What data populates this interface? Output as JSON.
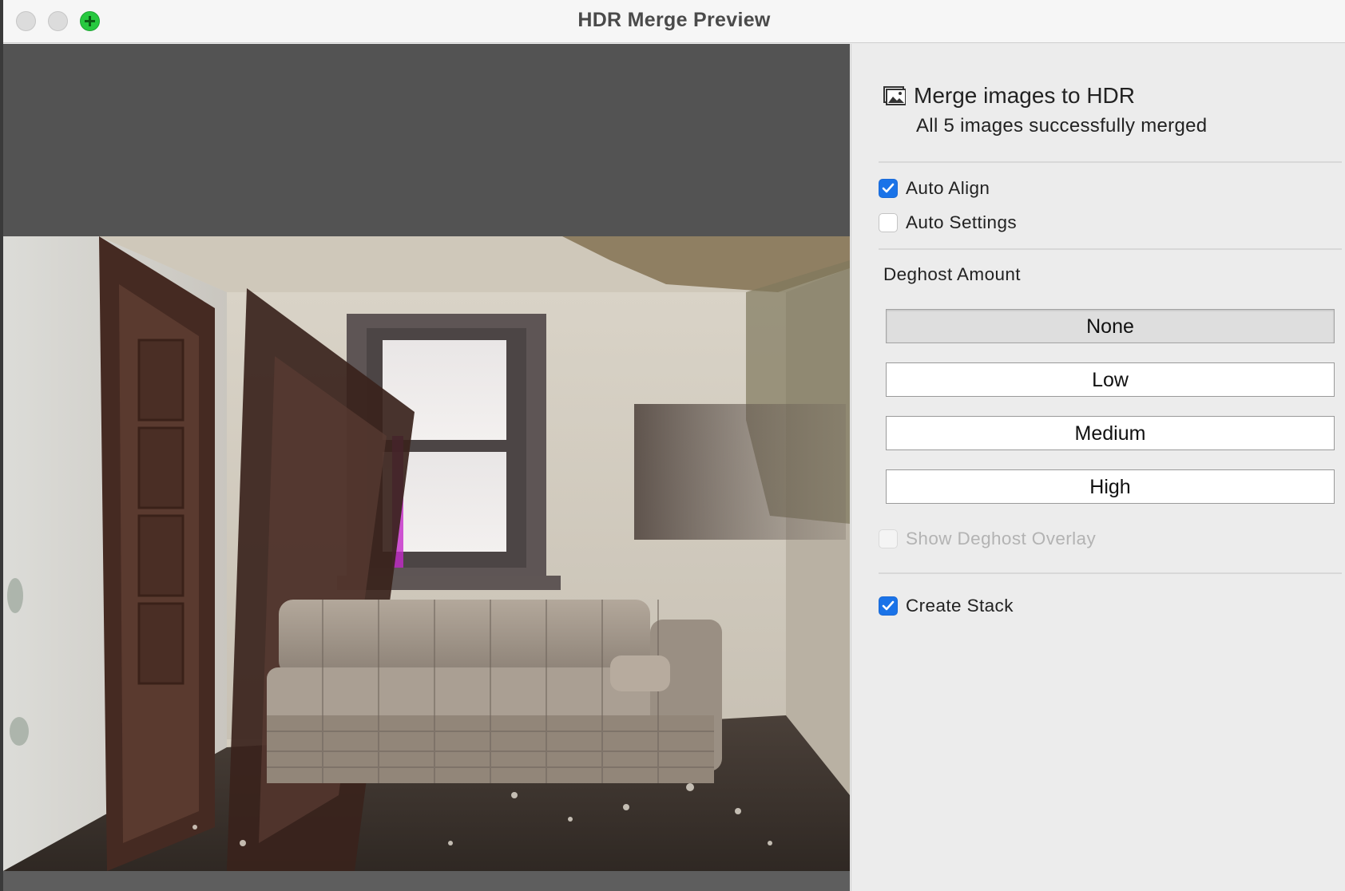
{
  "window": {
    "title": "HDR Merge Preview"
  },
  "icons": {
    "close": "close-traffic-light",
    "minimize": "minimize-traffic-light",
    "zoom": "zoom-traffic-light-plus",
    "header": "photo-stack-icon",
    "checkmark": "checkmark-icon"
  },
  "preview": {
    "image": "interior room photo: white peeling walls, two wooden doors, window, plaid sofa"
  },
  "panel": {
    "heading": "Merge images to HDR",
    "status": "All 5 images successfully merged",
    "auto_align": {
      "label": "Auto Align",
      "checked": true
    },
    "auto_settings": {
      "label": "Auto Settings",
      "checked": false
    },
    "deghost": {
      "label": "Deghost Amount",
      "options": [
        "None",
        "Low",
        "Medium",
        "High"
      ],
      "selected": "None"
    },
    "show_overlay": {
      "label": "Show Deghost Overlay",
      "checked": false,
      "enabled": false
    },
    "create_stack": {
      "label": "Create Stack",
      "checked": true
    }
  },
  "colors": {
    "accent": "#1a73e8",
    "zoom_green": "#27c93f",
    "preview_bg": "#535353",
    "panel_bg": "#ececec"
  }
}
